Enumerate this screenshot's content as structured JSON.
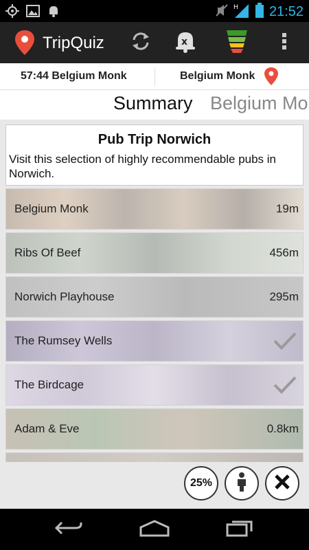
{
  "status_bar": {
    "time": "21:52",
    "icons": [
      "location-icon",
      "image-icon",
      "bell-icon",
      "mute-icon",
      "signal-icon",
      "battery-icon"
    ]
  },
  "action_bar": {
    "app_title": "TripQuiz",
    "icons": [
      "app-logo-pin-icon",
      "sync-icon",
      "cancel-bell-icon",
      "signal-strength-icon",
      "overflow-menu-icon"
    ]
  },
  "route_header": {
    "left_text": "57:44 Belgium Monk",
    "right_text": "Belgium Monk"
  },
  "tabs": [
    {
      "label": "Summary"
    },
    {
      "label": "Belgium Mo"
    }
  ],
  "trip": {
    "title": "Pub Trip Norwich",
    "description": "Visit this selection of highly recommendable pubs in Norwich."
  },
  "pubs": [
    {
      "name": "Belgium Monk",
      "distance": "19m"
    },
    {
      "name": "Ribs Of Beef",
      "distance": "456m"
    },
    {
      "name": "Norwich Playhouse",
      "distance": "295m"
    },
    {
      "name": "The Rumsey Wells",
      "distance": ""
    },
    {
      "name": "The Birdcage",
      "distance": ""
    },
    {
      "name": "Adam & Eve",
      "distance": "0.8km"
    }
  ],
  "bottom_bar": {
    "progress_label": "25%"
  },
  "colors": {
    "accent": "#33b5e5",
    "action_bar_bg": "#222222",
    "pin_red": "#e94e3c"
  }
}
